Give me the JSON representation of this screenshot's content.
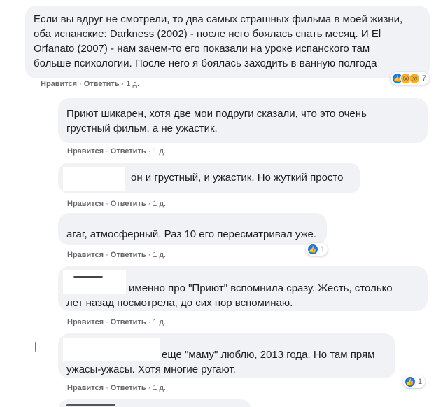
{
  "actions": {
    "like": "Нравится",
    "reply": "Ответить",
    "separator": "·",
    "time": "1 д."
  },
  "comments": [
    {
      "lines": [
        "Если вы вдруг не смотрели, то два самых страшных фильма в моей жизни,",
        "оба испанские: Darkness (2002) - после него боялась спать месяц. И El",
        "Orfanato (2007) - нам зачем-то его показали на уроке испанского там",
        "больше психологии. После него я боялась заходить в ванную полгода"
      ],
      "reactions": {
        "icons": [
          "like-icon",
          "wow-icon",
          "wow-icon"
        ],
        "count": "7"
      }
    },
    {
      "lines": [
        "Приют шикарен, хотя две мои подруги сказали, что это очень",
        "грустный фильм, а не ужастик."
      ]
    },
    {
      "lines": [
        "он и грустный, и ужастик. Но жуткий просто"
      ]
    },
    {
      "lines": [
        "агаг, атмосферный. Раз 10 его пересматривал уже."
      ],
      "reactions": {
        "icons": [
          "like-icon"
        ],
        "count": "1"
      }
    },
    {
      "lines": [
        "именно про \"Приют\" вспомнила сразу. Жесть, столько",
        "лет назад посмотрела, до сих пор вспоминаю."
      ]
    },
    {
      "lines": [
        "еще \"маму\" люблю, 2013 года. Но там прям",
        "ужасы-ужасы. Хотя многие ругают."
      ],
      "reactions": {
        "icons": [
          "like-icon"
        ],
        "count": "1"
      }
    }
  ],
  "colors": {
    "bubble": "#f0f2f5",
    "meta_text": "#65676b",
    "like_blue": "#1877f2",
    "wow_yellow": "#f7b125"
  }
}
